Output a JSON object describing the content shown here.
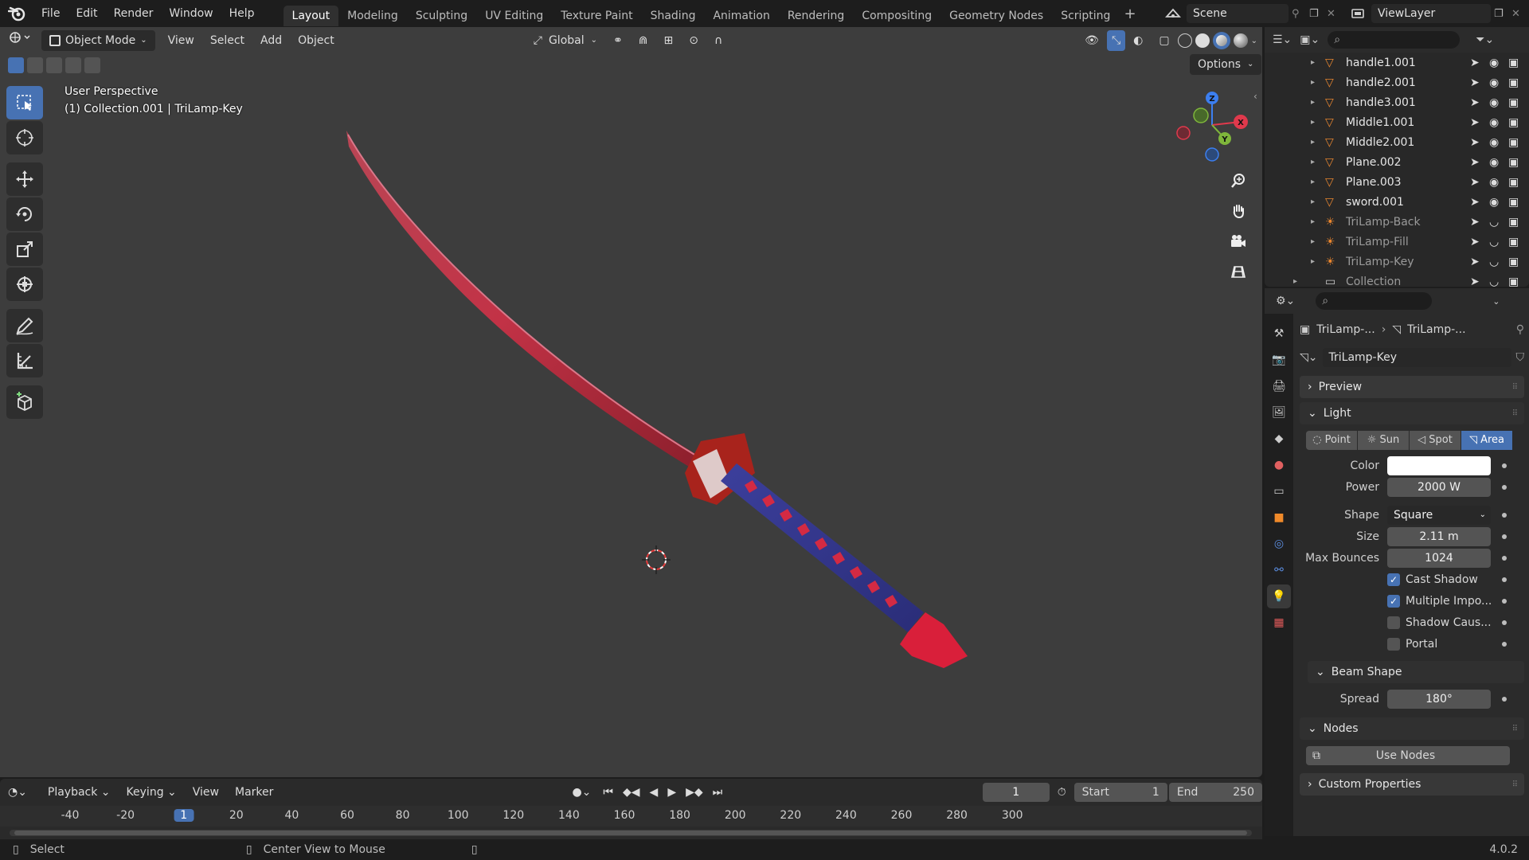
{
  "topbar": {
    "menus": [
      "File",
      "Edit",
      "Render",
      "Window",
      "Help"
    ],
    "workspaces": [
      "Layout",
      "Modeling",
      "Sculpting",
      "UV Editing",
      "Texture Paint",
      "Shading",
      "Animation",
      "Rendering",
      "Compositing",
      "Geometry Nodes",
      "Scripting"
    ],
    "active_workspace": "Layout",
    "scene": "Scene",
    "view_layer": "ViewLayer"
  },
  "viewport": {
    "mode": "Object Mode",
    "menus": [
      "View",
      "Select",
      "Add",
      "Object"
    ],
    "transform_orientation": "Global",
    "options_label": "Options",
    "overlay_line1": "User Perspective",
    "overlay_line2": "(1) Collection.001 | TriLamp-Key",
    "gizmo_axes": [
      "Z",
      "X",
      "Y"
    ]
  },
  "outliner": {
    "items": [
      {
        "name": "handle1.001",
        "dim": false
      },
      {
        "name": "handle2.001",
        "dim": false
      },
      {
        "name": "handle3.001",
        "dim": false
      },
      {
        "name": "Middle1.001",
        "dim": false
      },
      {
        "name": "Middle2.001",
        "dim": false
      },
      {
        "name": "Plane.002",
        "dim": false
      },
      {
        "name": "Plane.003",
        "dim": false
      },
      {
        "name": "sword.001",
        "dim": false
      },
      {
        "name": "TriLamp-Back",
        "dim": true
      },
      {
        "name": "TriLamp-Fill",
        "dim": true
      },
      {
        "name": "TriLamp-Key",
        "dim": true
      },
      {
        "name": "Collection",
        "dim": true
      }
    ]
  },
  "properties": {
    "breadcrumb": [
      "TriLamp-...",
      "TriLamp-..."
    ],
    "datablock": "TriLamp-Key",
    "panels": {
      "preview": "Preview",
      "light": "Light",
      "beam_shape": "Beam Shape",
      "nodes": "Nodes",
      "custom_properties": "Custom Properties"
    },
    "light_types": [
      "Point",
      "Sun",
      "Spot",
      "Area"
    ],
    "active_light_type": "Area",
    "color_label": "Color",
    "color_value": "#ffffff",
    "power_label": "Power",
    "power": "2000 W",
    "shape_label": "Shape",
    "shape": "Square",
    "size_label": "Size",
    "size": "2.11 m",
    "max_bounces_label": "Max Bounces",
    "max_bounces": "1024",
    "checkboxes": [
      {
        "label": "Cast Shadow",
        "checked": true
      },
      {
        "label": "Multiple Impo...",
        "checked": true
      },
      {
        "label": "Shadow Caus...",
        "checked": false
      },
      {
        "label": "Portal",
        "checked": false
      }
    ],
    "spread_label": "Spread",
    "spread": "180°",
    "use_nodes": "Use Nodes"
  },
  "timeline": {
    "menus": [
      "Playback",
      "Keying",
      "View",
      "Marker"
    ],
    "current_frame": "1",
    "start_label": "Start",
    "start": "1",
    "end_label": "End",
    "end": "250",
    "ruler": [
      "-40",
      "-20",
      "1",
      "20",
      "40",
      "60",
      "80",
      "100",
      "120",
      "140",
      "160",
      "180",
      "200",
      "220",
      "240",
      "260",
      "280",
      "300"
    ]
  },
  "statusbar": {
    "select": "Select",
    "center_view": "Center View to Mouse",
    "version": "4.0.2"
  },
  "colors": {
    "accent": "#4772b3",
    "viewport_bg": "#3d3d3d",
    "x_axis": "#e0394c",
    "y_axis": "#7fb63b",
    "z_axis": "#3c7ff0"
  }
}
